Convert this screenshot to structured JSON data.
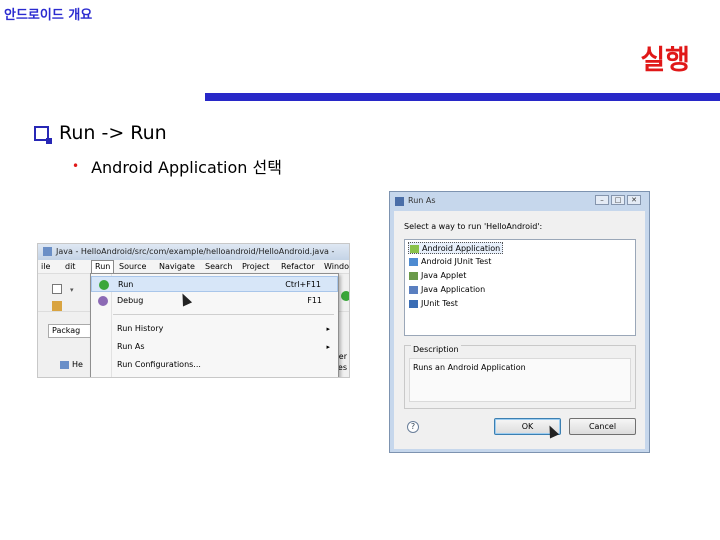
{
  "header": {
    "title": "안드로이드 개요"
  },
  "slide": {
    "title": "실행",
    "bullet1": "Run -> Run",
    "bullet2": "Android Application 선택"
  },
  "eclipse": {
    "window_title": "Java - HelloAndroid/src/com/example/helloandroid/HelloAndroid.java -",
    "menubar": [
      "ile",
      "dit",
      "Run",
      "Source",
      "Navigate",
      "Search",
      "Project",
      "Refactor",
      "Windo"
    ],
    "active_menu": "Run",
    "package_tab": "Packag",
    "tree_item": "He",
    "run_menu": {
      "run": {
        "label": "Run",
        "shortcut": "Ctrl+F11"
      },
      "debug": {
        "label": "Debug",
        "shortcut": "F11"
      },
      "run_history": "Run History",
      "run_as": "Run As",
      "run_configurations": "Run Configurations...",
      "submenu_arrow": "▸"
    },
    "right_clip": [
      "er",
      "es"
    ]
  },
  "dialog": {
    "title": "Run As",
    "prompt": "Select a way to run 'HelloAndroid':",
    "options": [
      "Android Application",
      "Android JUnit Test",
      "Java Applet",
      "Java Application",
      "JUnit Test"
    ],
    "selected_option": "Android Application",
    "description_label": "Description",
    "description_text": "Runs an Android Application",
    "help_symbol": "?",
    "ok_label": "OK",
    "cancel_label": "Cancel",
    "window_controls": [
      "–",
      "□",
      "✕"
    ]
  },
  "colors": {
    "header_blue": "#2b2bd0",
    "title_red": "#e01818",
    "rule_blue": "#2828c8",
    "bullet_square": "#2727b5",
    "bullet_dot": "#e01818"
  }
}
